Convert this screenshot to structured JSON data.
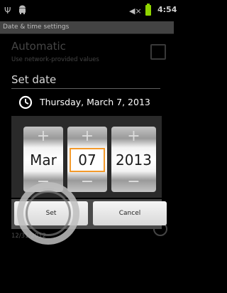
{
  "status_bar": {
    "time": "4:54",
    "icons": [
      "usb-icon",
      "android-icon",
      "volume-muted-icon",
      "battery-icon"
    ],
    "battery_color": "#8fd400"
  },
  "screen": {
    "title": "Date & time settings",
    "automatic": {
      "title": "Automatic",
      "subtitle": "Use network-provided values"
    },
    "background_date": "12/31/2012"
  },
  "dialog": {
    "title": "Set date",
    "header_date": "Thursday, March 7, 2013",
    "pickers": [
      {
        "plus": "+",
        "value": "Mar",
        "minus": "−"
      },
      {
        "plus": "+",
        "value": "07",
        "minus": "−"
      },
      {
        "plus": "+",
        "value": "2013",
        "minus": "−"
      }
    ],
    "focused_picker": "day",
    "focus_color": "#f39a2b",
    "buttons": {
      "set": "Set",
      "cancel": "Cancel"
    }
  }
}
